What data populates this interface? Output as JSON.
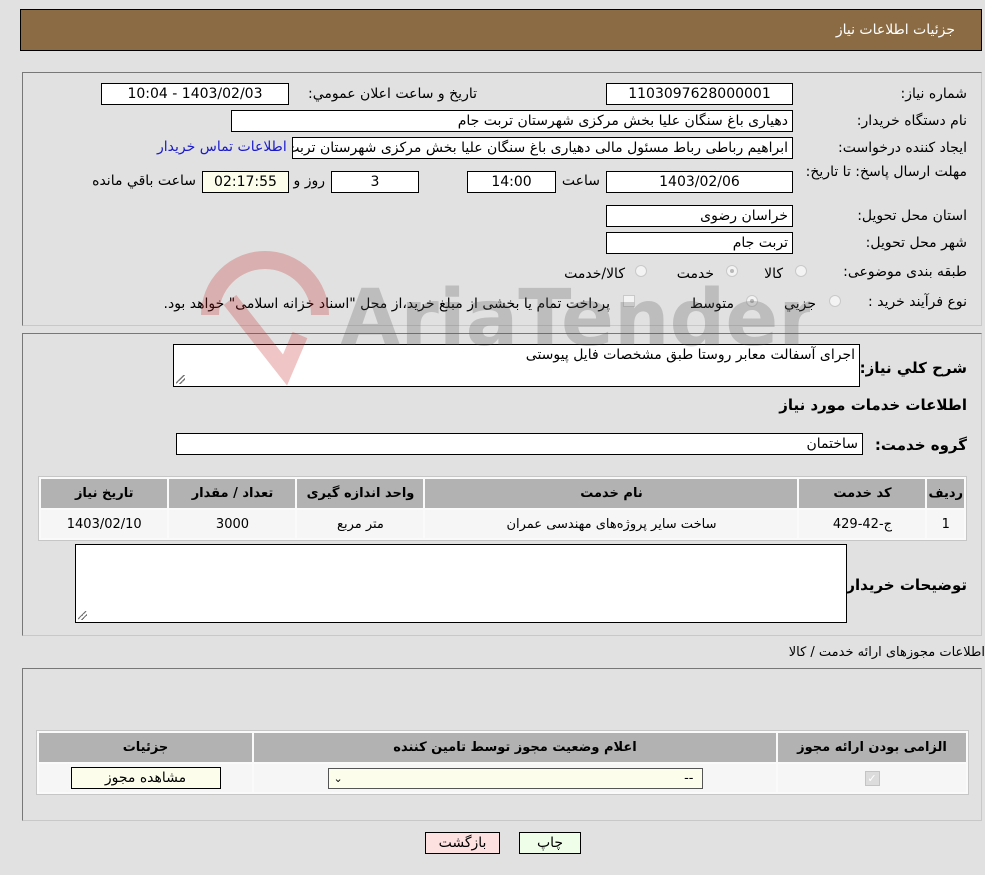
{
  "header": {
    "title": "جزئیات اطلاعات نیاز"
  },
  "details": {
    "need_number_label": "شماره نیاز:",
    "need_number": "1103097628000001",
    "announce_label": "تاریخ و ساعت اعلان عمومي:",
    "announce_value": "1403/02/03 - 10:04",
    "buyer_org_label": "نام دستگاه خریدار:",
    "buyer_org": "دهیاری باغ سنگان علیا بخش مرکزی شهرستان تربت جام",
    "requester_label": "ایجاد کننده درخواست:",
    "requester": "ابراهیم رباطی رباط مسئول مالی دهیاری باغ سنگان علیا بخش مرکزی شهرستان تربت جام",
    "buyer_contact_link": "اطلاعات تماس خریدار",
    "deadline_label": "مهلت ارسال پاسخ: تا تاریخ:",
    "deadline_date": "1403/02/06",
    "time_label": "ساعت",
    "deadline_time": "14:00",
    "days_value": "3",
    "days_label": "روز و",
    "remaining_time": "02:17:55",
    "remaining_label": "ساعت باقي مانده",
    "province_label": "استان محل تحویل:",
    "province": "خراسان رضوی",
    "city_label": "شهر محل تحویل:",
    "city": "تربت جام",
    "category_label": "طبقه بندی موضوعی:",
    "category_options": [
      {
        "label": "کالا",
        "checked": false
      },
      {
        "label": "خدمت",
        "checked": true
      },
      {
        "label": "کالا/خدمت",
        "checked": false
      }
    ],
    "process_label": "نوع فرآیند خرید :",
    "process_options": [
      {
        "label": "جزيي",
        "checked": false
      },
      {
        "label": "متوسط",
        "checked": true
      }
    ],
    "treasury_note": "پرداخت تمام یا بخشی از مبلغ خرید،از محل \"اسناد خزانه اسلامی\" خواهد بود."
  },
  "services": {
    "description_label": "شرح کلي نیاز:",
    "description": "اجرای آسفالت معابر روستا طبق مشخصات  فایل پیوستی",
    "section_title": "اطلاعات خدمات مورد نیاز",
    "group_label": "گروه خدمت:",
    "group_value": "ساختمان",
    "table": {
      "headers": [
        "ردیف",
        "کد خدمت",
        "نام خدمت",
        "واحد اندازه گیری",
        "تعداد / مقدار",
        "تاریخ نیاز"
      ],
      "rows": [
        [
          "1",
          "ج-42-429",
          "ساخت سایر پروژه‌های مهندسی عمران",
          "متر مربع",
          "3000",
          "1403/02/10"
        ]
      ]
    },
    "buyer_notes_label": "توضیحات خریدار:",
    "buyer_notes": ""
  },
  "permits": {
    "section_title": "اطلاعات مجوزهای ارائه خدمت / کالا",
    "headers": [
      "الزامی بودن ارائه مجوز",
      "اعلام وضعیت مجوز توسط تامین کننده",
      "جزئیات"
    ],
    "row": {
      "required_checked": true,
      "status_value": "--",
      "details_button": "مشاهده مجوز"
    }
  },
  "actions": {
    "print": "چاپ",
    "back": "بازگشت"
  },
  "watermark": "AriaTender.neT"
}
